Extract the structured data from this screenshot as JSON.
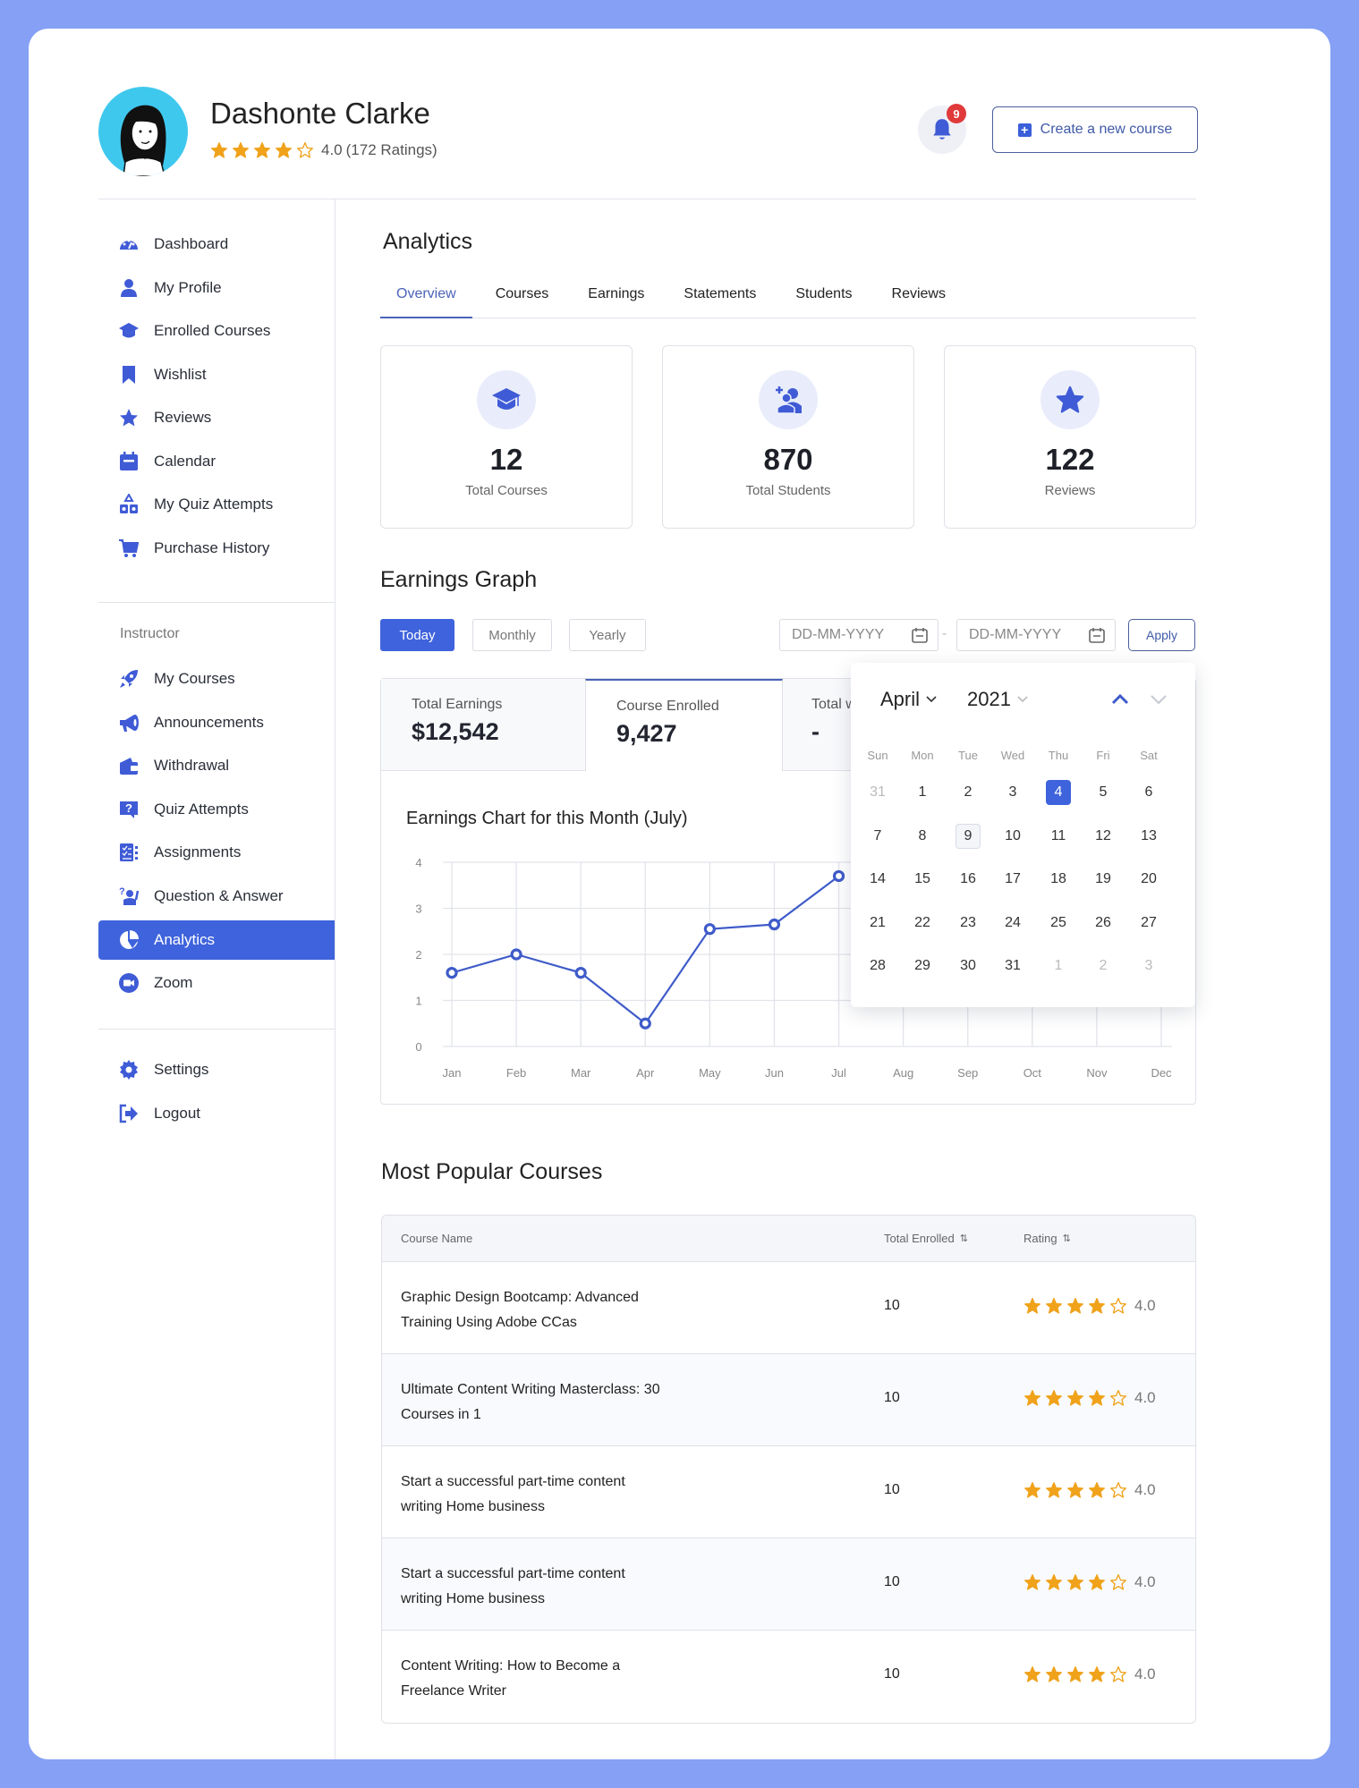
{
  "colors": {
    "background": "#85a0f5",
    "accent": "#3f63dc",
    "star": "#f0a21a",
    "badge": "#e03a3a"
  },
  "header": {
    "user_name": "Dashonte Clarke",
    "rating_value": "4.0",
    "rating_count_label": "(172 Ratings)",
    "stars_filled": 4,
    "stars_total": 5,
    "notification_count": "9",
    "create_course_label": "Create a new course"
  },
  "sidebar": {
    "items": [
      {
        "label": "Dashboard",
        "icon": "dashboard-icon"
      },
      {
        "label": "My Profile",
        "icon": "user-icon"
      },
      {
        "label": "Enrolled Courses",
        "icon": "graduation-cap-icon"
      },
      {
        "label": "Wishlist",
        "icon": "bookmark-icon"
      },
      {
        "label": "Reviews",
        "icon": "star-icon"
      },
      {
        "label": "Calendar",
        "icon": "calendar-icon"
      },
      {
        "label": "My Quiz Attempts",
        "icon": "shapes-icon"
      },
      {
        "label": "Purchase History",
        "icon": "cart-icon"
      }
    ],
    "instructor_heading": "Instructor",
    "instructor_items": [
      {
        "label": "My Courses",
        "icon": "rocket-icon"
      },
      {
        "label": "Announcements",
        "icon": "megaphone-icon"
      },
      {
        "label": "Withdrawal",
        "icon": "wallet-icon"
      },
      {
        "label": "Quiz Attempts",
        "icon": "question-chat-icon"
      },
      {
        "label": "Assignments",
        "icon": "checklist-icon"
      },
      {
        "label": "Question & Answer",
        "icon": "question-person-icon"
      },
      {
        "label": "Analytics",
        "icon": "pie-chart-icon",
        "active": true
      },
      {
        "label": "Zoom",
        "icon": "video-camera-icon"
      }
    ],
    "bottom_items": [
      {
        "label": "Settings",
        "icon": "gear-icon"
      },
      {
        "label": "Logout",
        "icon": "logout-icon"
      }
    ]
  },
  "main": {
    "title": "Analytics",
    "tabs": [
      {
        "label": "Overview",
        "active": true
      },
      {
        "label": "Courses"
      },
      {
        "label": "Earnings"
      },
      {
        "label": "Statements"
      },
      {
        "label": "Students"
      },
      {
        "label": "Reviews"
      }
    ],
    "stats": [
      {
        "value": "12",
        "label": "Total Courses",
        "icon": "graduation-cap-icon"
      },
      {
        "value": "870",
        "label": "Total Students",
        "icon": "add-users-icon"
      },
      {
        "value": "122",
        "label": "Reviews",
        "icon": "star-icon"
      }
    ]
  },
  "earnings": {
    "title": "Earnings Graph",
    "ranges": [
      {
        "label": "Today",
        "active": true
      },
      {
        "label": "Monthly"
      },
      {
        "label": "Yearly"
      }
    ],
    "date_from_placeholder": "DD-MM-YYYY",
    "date_separator": "-",
    "date_to_placeholder": "DD-MM-YYYY",
    "apply_label": "Apply",
    "metrics": [
      {
        "label": "Total Earnings",
        "value": "$12,542"
      },
      {
        "label": "Course Enrolled",
        "value": "9,427",
        "active": true
      },
      {
        "label": "Total w",
        "value": "-"
      }
    ]
  },
  "calendar": {
    "month": "April",
    "year": "2021",
    "weekdays": [
      "Sun",
      "Mon",
      "Tue",
      "Wed",
      "Thu",
      "Fri",
      "Sat"
    ],
    "weeks": [
      [
        {
          "d": "31",
          "muted": true
        },
        {
          "d": "1"
        },
        {
          "d": "2"
        },
        {
          "d": "3"
        },
        {
          "d": "4",
          "selected": true
        },
        {
          "d": "5"
        },
        {
          "d": "6"
        }
      ],
      [
        {
          "d": "7"
        },
        {
          "d": "8"
        },
        {
          "d": "9",
          "today": true
        },
        {
          "d": "10"
        },
        {
          "d": "11"
        },
        {
          "d": "12"
        },
        {
          "d": "13"
        }
      ],
      [
        {
          "d": "14"
        },
        {
          "d": "15"
        },
        {
          "d": "16"
        },
        {
          "d": "17"
        },
        {
          "d": "18"
        },
        {
          "d": "19"
        },
        {
          "d": "20"
        }
      ],
      [
        {
          "d": "21"
        },
        {
          "d": "22"
        },
        {
          "d": "23"
        },
        {
          "d": "24"
        },
        {
          "d": "25"
        },
        {
          "d": "26"
        },
        {
          "d": "27"
        }
      ],
      [
        {
          "d": "28"
        },
        {
          "d": "29"
        },
        {
          "d": "30"
        },
        {
          "d": "31"
        },
        {
          "d": "1",
          "muted": true
        },
        {
          "d": "2",
          "muted": true
        },
        {
          "d": "3",
          "muted": true
        }
      ]
    ]
  },
  "chart_data": {
    "type": "line",
    "title": "Earnings Chart for this Month (July)",
    "xlabel": "",
    "ylabel": "",
    "categories": [
      "Jan",
      "Feb",
      "Mar",
      "Apr",
      "May",
      "Jun",
      "Jul",
      "Aug",
      "Sep",
      "Oct",
      "Nov",
      "Dec"
    ],
    "series": [
      {
        "name": "Earnings",
        "values": [
          1.6,
          2.0,
          1.6,
          0.5,
          2.55,
          2.65,
          3.7
        ]
      }
    ],
    "yticks": [
      "0",
      "1",
      "2",
      "3",
      "4"
    ],
    "ylim": [
      0,
      4
    ],
    "grid": true,
    "legend": "none",
    "color": "#3f5bc9"
  },
  "popular": {
    "title": "Most Popular Courses",
    "columns": [
      "Course Name",
      "Total Enrolled",
      "Rating"
    ],
    "rows": [
      {
        "name": "Graphic Design Bootcamp: Advanced Training Using Adobe CCas",
        "enrolled": "10",
        "rating": "4.0",
        "stars": 4
      },
      {
        "name": "Ultimate Content Writing Masterclass: 30 Courses in 1",
        "enrolled": "10",
        "rating": "4.0",
        "stars": 4
      },
      {
        "name": "Start a successful part-time content writing Home business",
        "enrolled": "10",
        "rating": "4.0",
        "stars": 4
      },
      {
        "name": "Start a successful part-time content writing Home business",
        "enrolled": "10",
        "rating": "4.0",
        "stars": 4
      },
      {
        "name": "Content Writing: How to Become a Freelance Writer",
        "enrolled": "10",
        "rating": "4.0",
        "stars": 4
      }
    ]
  }
}
